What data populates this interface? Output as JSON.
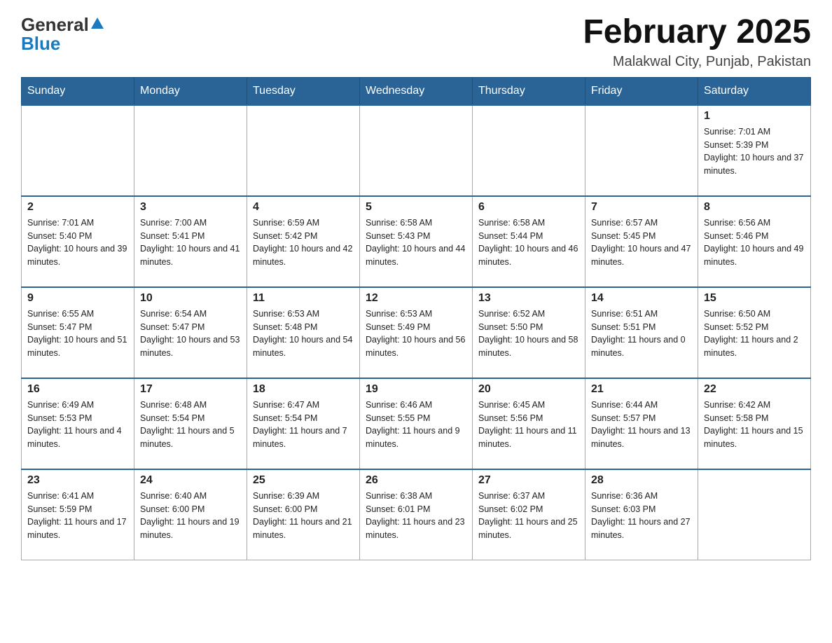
{
  "logo": {
    "general": "General",
    "triangle": "▲",
    "blue": "Blue"
  },
  "title": "February 2025",
  "subtitle": "Malakwal City, Punjab, Pakistan",
  "days_of_week": [
    "Sunday",
    "Monday",
    "Tuesday",
    "Wednesday",
    "Thursday",
    "Friday",
    "Saturday"
  ],
  "weeks": [
    [
      {
        "day": "",
        "info": ""
      },
      {
        "day": "",
        "info": ""
      },
      {
        "day": "",
        "info": ""
      },
      {
        "day": "",
        "info": ""
      },
      {
        "day": "",
        "info": ""
      },
      {
        "day": "",
        "info": ""
      },
      {
        "day": "1",
        "info": "Sunrise: 7:01 AM\nSunset: 5:39 PM\nDaylight: 10 hours and 37 minutes."
      }
    ],
    [
      {
        "day": "2",
        "info": "Sunrise: 7:01 AM\nSunset: 5:40 PM\nDaylight: 10 hours and 39 minutes."
      },
      {
        "day": "3",
        "info": "Sunrise: 7:00 AM\nSunset: 5:41 PM\nDaylight: 10 hours and 41 minutes."
      },
      {
        "day": "4",
        "info": "Sunrise: 6:59 AM\nSunset: 5:42 PM\nDaylight: 10 hours and 42 minutes."
      },
      {
        "day": "5",
        "info": "Sunrise: 6:58 AM\nSunset: 5:43 PM\nDaylight: 10 hours and 44 minutes."
      },
      {
        "day": "6",
        "info": "Sunrise: 6:58 AM\nSunset: 5:44 PM\nDaylight: 10 hours and 46 minutes."
      },
      {
        "day": "7",
        "info": "Sunrise: 6:57 AM\nSunset: 5:45 PM\nDaylight: 10 hours and 47 minutes."
      },
      {
        "day": "8",
        "info": "Sunrise: 6:56 AM\nSunset: 5:46 PM\nDaylight: 10 hours and 49 minutes."
      }
    ],
    [
      {
        "day": "9",
        "info": "Sunrise: 6:55 AM\nSunset: 5:47 PM\nDaylight: 10 hours and 51 minutes."
      },
      {
        "day": "10",
        "info": "Sunrise: 6:54 AM\nSunset: 5:47 PM\nDaylight: 10 hours and 53 minutes."
      },
      {
        "day": "11",
        "info": "Sunrise: 6:53 AM\nSunset: 5:48 PM\nDaylight: 10 hours and 54 minutes."
      },
      {
        "day": "12",
        "info": "Sunrise: 6:53 AM\nSunset: 5:49 PM\nDaylight: 10 hours and 56 minutes."
      },
      {
        "day": "13",
        "info": "Sunrise: 6:52 AM\nSunset: 5:50 PM\nDaylight: 10 hours and 58 minutes."
      },
      {
        "day": "14",
        "info": "Sunrise: 6:51 AM\nSunset: 5:51 PM\nDaylight: 11 hours and 0 minutes."
      },
      {
        "day": "15",
        "info": "Sunrise: 6:50 AM\nSunset: 5:52 PM\nDaylight: 11 hours and 2 minutes."
      }
    ],
    [
      {
        "day": "16",
        "info": "Sunrise: 6:49 AM\nSunset: 5:53 PM\nDaylight: 11 hours and 4 minutes."
      },
      {
        "day": "17",
        "info": "Sunrise: 6:48 AM\nSunset: 5:54 PM\nDaylight: 11 hours and 5 minutes."
      },
      {
        "day": "18",
        "info": "Sunrise: 6:47 AM\nSunset: 5:54 PM\nDaylight: 11 hours and 7 minutes."
      },
      {
        "day": "19",
        "info": "Sunrise: 6:46 AM\nSunset: 5:55 PM\nDaylight: 11 hours and 9 minutes."
      },
      {
        "day": "20",
        "info": "Sunrise: 6:45 AM\nSunset: 5:56 PM\nDaylight: 11 hours and 11 minutes."
      },
      {
        "day": "21",
        "info": "Sunrise: 6:44 AM\nSunset: 5:57 PM\nDaylight: 11 hours and 13 minutes."
      },
      {
        "day": "22",
        "info": "Sunrise: 6:42 AM\nSunset: 5:58 PM\nDaylight: 11 hours and 15 minutes."
      }
    ],
    [
      {
        "day": "23",
        "info": "Sunrise: 6:41 AM\nSunset: 5:59 PM\nDaylight: 11 hours and 17 minutes."
      },
      {
        "day": "24",
        "info": "Sunrise: 6:40 AM\nSunset: 6:00 PM\nDaylight: 11 hours and 19 minutes."
      },
      {
        "day": "25",
        "info": "Sunrise: 6:39 AM\nSunset: 6:00 PM\nDaylight: 11 hours and 21 minutes."
      },
      {
        "day": "26",
        "info": "Sunrise: 6:38 AM\nSunset: 6:01 PM\nDaylight: 11 hours and 23 minutes."
      },
      {
        "day": "27",
        "info": "Sunrise: 6:37 AM\nSunset: 6:02 PM\nDaylight: 11 hours and 25 minutes."
      },
      {
        "day": "28",
        "info": "Sunrise: 6:36 AM\nSunset: 6:03 PM\nDaylight: 11 hours and 27 minutes."
      },
      {
        "day": "",
        "info": ""
      }
    ]
  ]
}
